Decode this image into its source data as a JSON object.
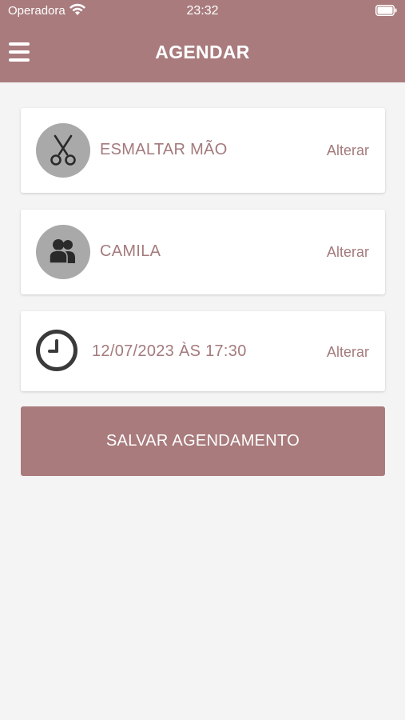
{
  "status_bar": {
    "carrier": "Operadora",
    "time": "23:32"
  },
  "header": {
    "title": "AGENDAR",
    "menu_icon": "hamburger-menu-icon"
  },
  "cards": [
    {
      "icon": "scissors-icon",
      "label": "ESMALTAR MÃO",
      "action": "Alterar"
    },
    {
      "icon": "people-icon",
      "label": "CAMILA",
      "action": "Alterar"
    },
    {
      "icon": "clock-icon",
      "label": "12/07/2023 ÀS 17:30",
      "action": "Alterar"
    }
  ],
  "save_button": {
    "label": "SALVAR AGENDAMENTO"
  },
  "colors": {
    "primary": "#a97b7d",
    "text_accent": "#a47a7c",
    "background": "#f4f4f4",
    "icon_circle": "#a9a9a9"
  }
}
